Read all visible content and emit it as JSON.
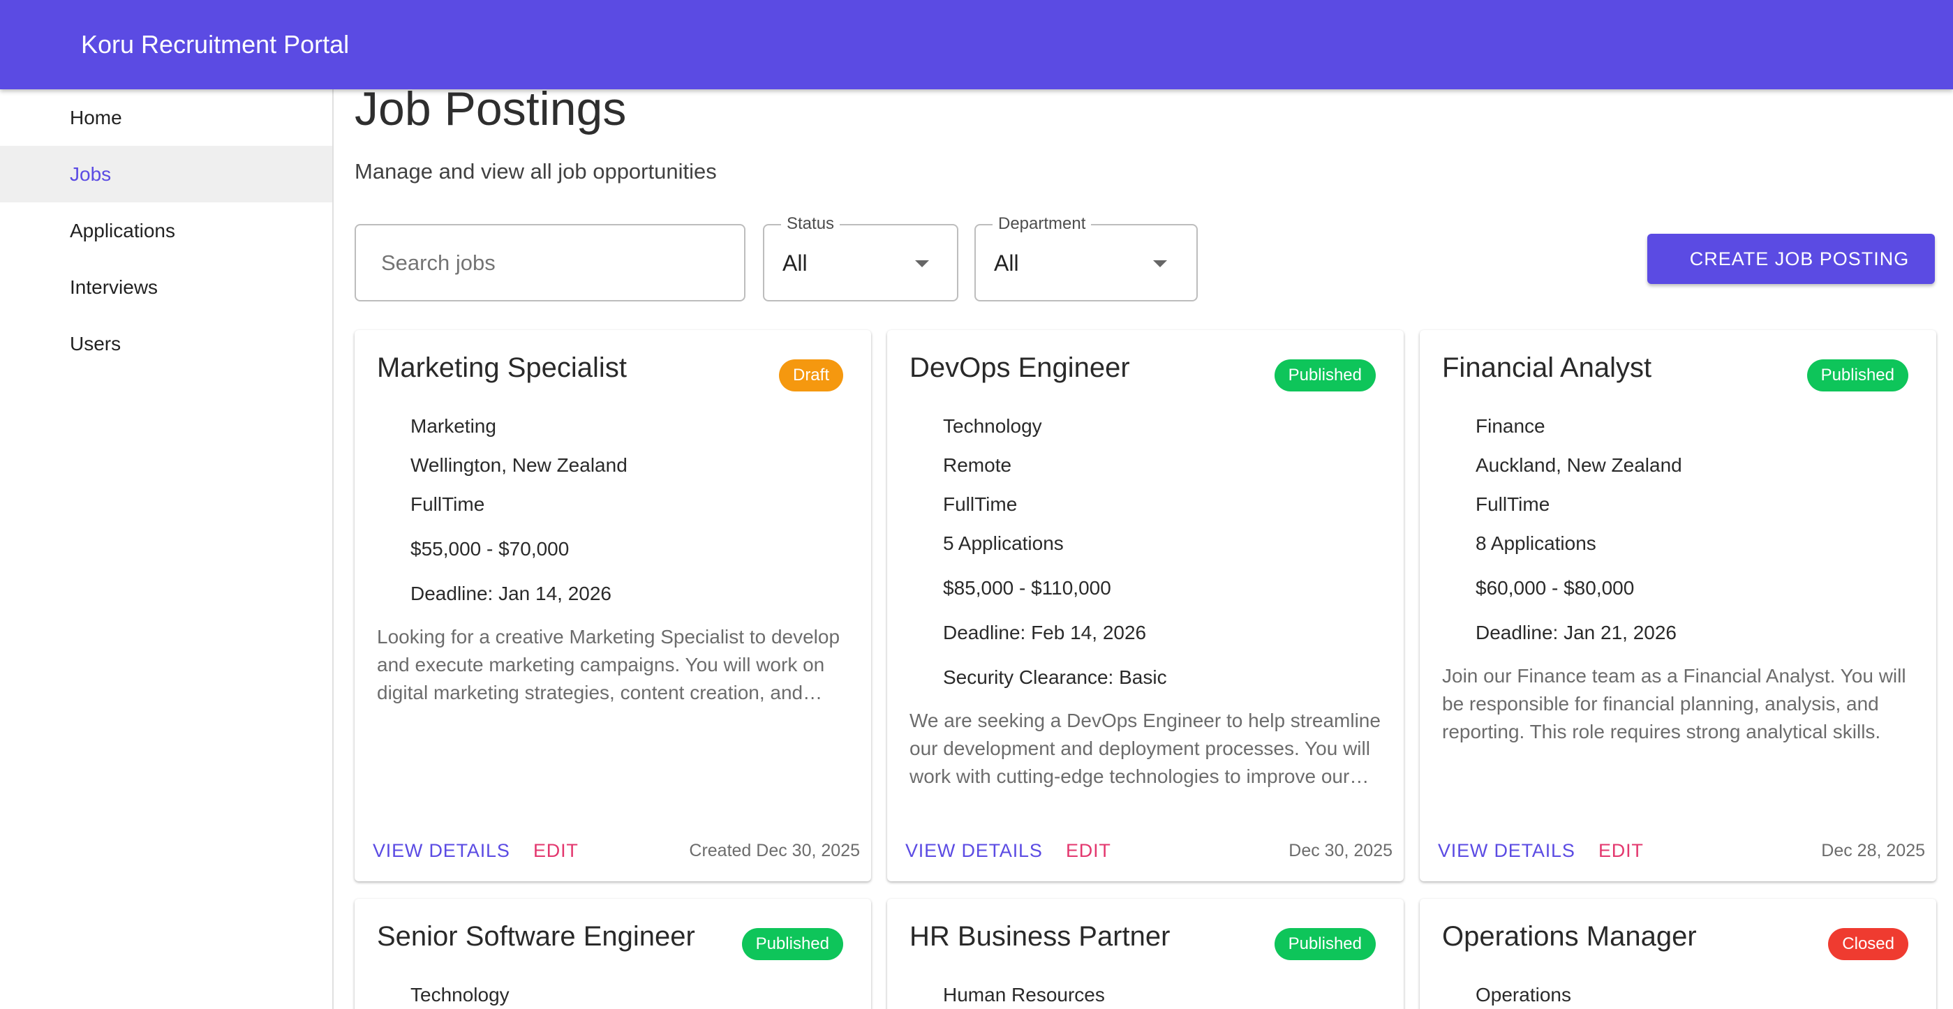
{
  "app": {
    "title": "Koru Recruitment Portal"
  },
  "colors": {
    "primary": "#5b4be3",
    "edit": "#e3376e",
    "draft": "#f5980f",
    "published": "#0ec55a",
    "closed": "#ef3b30"
  },
  "sidebar": {
    "items": [
      {
        "label": "Home"
      },
      {
        "label": "Jobs",
        "active": true
      },
      {
        "label": "Applications"
      },
      {
        "label": "Interviews"
      },
      {
        "label": "Users"
      }
    ]
  },
  "page": {
    "title": "Job Postings",
    "subtitle": "Manage and view all job opportunities"
  },
  "filters": {
    "search_placeholder": "Search jobs",
    "status_label": "Status",
    "status_value": "All",
    "department_label": "Department",
    "department_value": "All"
  },
  "create_button": "CREATE JOB POSTING",
  "card_actions": {
    "view": "VIEW DETAILS",
    "edit": "EDIT"
  },
  "jobs": [
    {
      "title": "Marketing Specialist",
      "status": "Draft",
      "department": "Marketing",
      "location": "Wellington, New Zealand",
      "type": "FullTime",
      "salary": "$55,000 - $70,000",
      "deadline": "Deadline: Jan 14, 2026",
      "description": "Looking for a creative Marketing Specialist to develop and execute marketing campaigns. You will work on digital marketing strategies, content creation, and brand management.",
      "date": "Created Dec 30, 2025"
    },
    {
      "title": "DevOps Engineer",
      "status": "Published",
      "department": "Technology",
      "location": "Remote",
      "type": "FullTime",
      "applications": "5 Applications",
      "salary": "$85,000 - $110,000",
      "deadline": "Deadline: Feb 14, 2026",
      "clearance": "Security Clearance: Basic",
      "description": "We are seeking a DevOps Engineer to help streamline our development and deployment processes. You will work with cutting-edge technologies to improve our infrastructure.",
      "date": "Dec 30, 2025"
    },
    {
      "title": "Financial Analyst",
      "status": "Published",
      "department": "Finance",
      "location": "Auckland, New Zealand",
      "type": "FullTime",
      "applications": "8 Applications",
      "salary": "$60,000 - $80,000",
      "deadline": "Deadline: Jan 21, 2026",
      "description": "Join our Finance team as a Financial Analyst. You will be responsible for financial planning, analysis, and reporting. This role requires strong analytical skills.",
      "date": "Dec 28, 2025"
    },
    {
      "title": "Senior Software Engineer",
      "status": "Published",
      "department": "Technology"
    },
    {
      "title": "HR Business Partner",
      "status": "Published",
      "department": "Human Resources"
    },
    {
      "title": "Operations Manager",
      "status": "Closed",
      "department": "Operations"
    }
  ]
}
